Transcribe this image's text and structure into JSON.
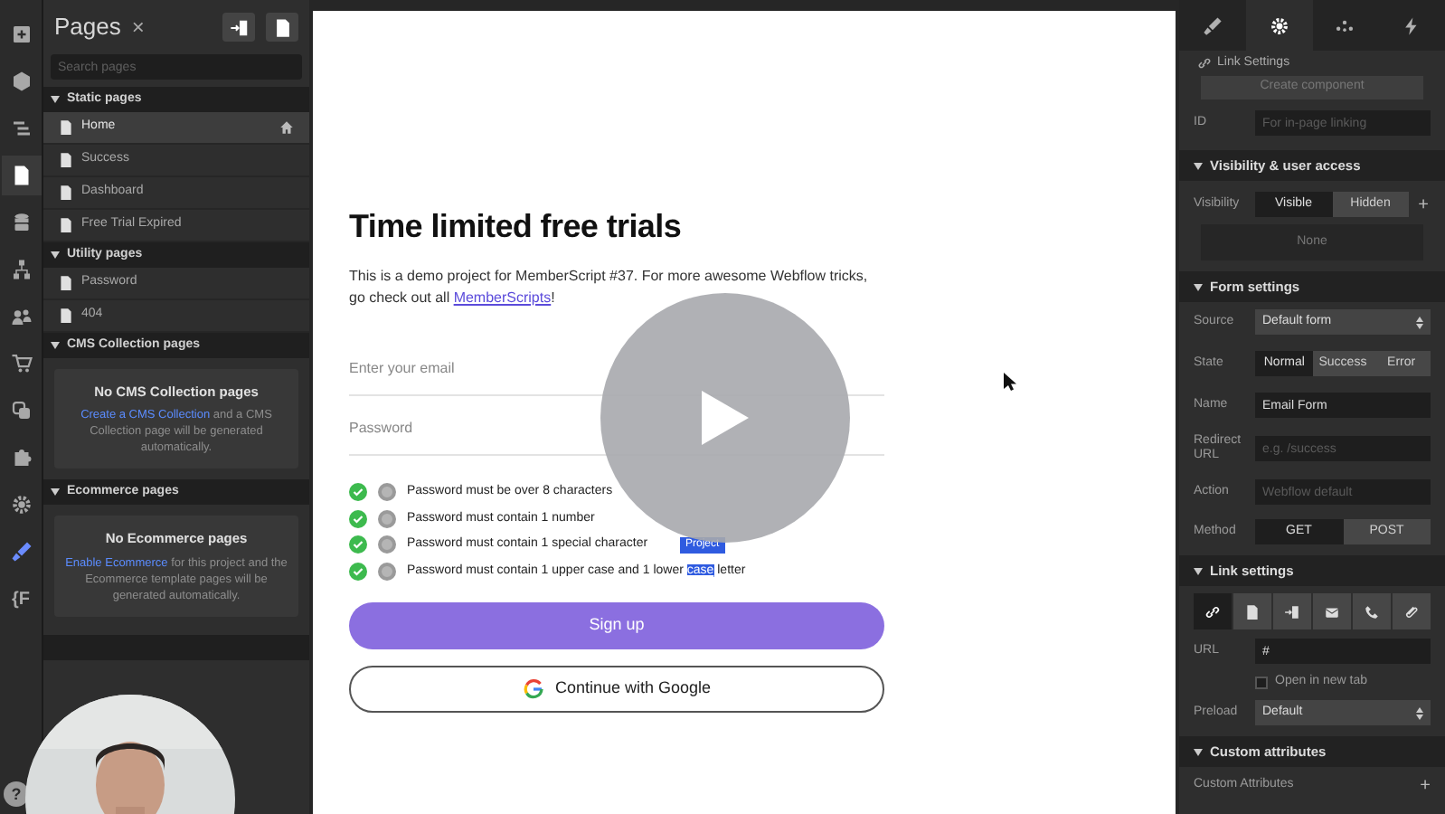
{
  "rail": [
    {
      "kind": "plus",
      "selected": false
    },
    {
      "kind": "cube",
      "selected": false
    },
    {
      "kind": "navigator",
      "selected": false
    },
    {
      "kind": "page",
      "selected": true
    },
    {
      "kind": "database",
      "selected": false
    },
    {
      "kind": "sitemap",
      "selected": false
    },
    {
      "kind": "users",
      "selected": false
    },
    {
      "kind": "cart",
      "selected": false
    },
    {
      "kind": "layers",
      "selected": false
    },
    {
      "kind": "puzzle",
      "selected": false
    },
    {
      "kind": "gear",
      "selected": false
    },
    {
      "kind": "brush",
      "selected": false
    },
    {
      "kind": "text",
      "label": "{F",
      "selected": false
    }
  ],
  "help": "?",
  "pages_panel": {
    "title": "Pages",
    "close": "×",
    "search": {
      "placeholder": "Search pages"
    },
    "sections": [
      {
        "title": "Static pages",
        "pages": [
          {
            "name": "Home",
            "selected": true,
            "home": true
          },
          {
            "name": "Success",
            "selected": false,
            "home": false
          },
          {
            "name": "Dashboard",
            "selected": false,
            "home": false
          },
          {
            "name": "Free Trial Expired",
            "selected": false,
            "home": false
          }
        ]
      },
      {
        "title": "Utility pages",
        "pages": [
          {
            "name": "Password",
            "selected": false,
            "home": false
          },
          {
            "name": "404",
            "selected": false,
            "home": false
          }
        ]
      },
      {
        "title": "CMS Collection pages",
        "empty": {
          "heading": "No CMS Collection pages",
          "link": "Create a CMS Collection",
          "text": " and a CMS Collection page will be generated automatically."
        }
      },
      {
        "title": "Ecommerce pages",
        "empty": {
          "heading": "No Ecommerce pages",
          "link": "Enable Ecommerce",
          "text": " for this project and the Ecommerce template pages will be generated automatically."
        }
      }
    ]
  },
  "canvas": {
    "heading": "Time limited free trials",
    "intro": "This is a demo project for MemberScript #37. For more awesome Webflow tricks, go check out all ",
    "intro_link": "MemberScripts",
    "intro_end": "!",
    "fields": [
      {
        "placeholder": "Enter your email"
      },
      {
        "placeholder": "Password"
      }
    ],
    "requirements": [
      {
        "text": "Password must be over 8 characters",
        "done": true
      },
      {
        "text": "Password must contain 1 number",
        "done": true
      },
      {
        "text": "Password must contain 1 special character",
        "done": true
      },
      {
        "text": "Password must contain 1 upper case and 1 lower ",
        "highlight": "case",
        "after": " letter",
        "done": true
      }
    ],
    "tag": "Project",
    "signup": "Sign up",
    "google": "Continue with Google"
  },
  "right_panel": {
    "tabs": [
      {
        "kind": "brush",
        "selected": false
      },
      {
        "kind": "gear",
        "selected": true
      },
      {
        "kind": "interactions",
        "selected": false
      },
      {
        "kind": "bolt",
        "selected": false
      }
    ],
    "link_settings_label": "Link Settings",
    "create_component": "Create component",
    "id_label": "ID",
    "id_placeholder": "For in-page linking",
    "visibility": {
      "title": "Visibility & user access",
      "label": "Visibility",
      "options": [
        {
          "label": "Visible",
          "selected": true
        },
        {
          "label": "Hidden",
          "selected": false
        }
      ],
      "add": "+",
      "none": "None"
    },
    "form": {
      "title": "Form settings",
      "source_label": "Source",
      "source": "Default form",
      "state_label": "State",
      "states": [
        {
          "label": "Normal",
          "selected": true
        },
        {
          "label": "Success",
          "selected": false
        },
        {
          "label": "Error",
          "selected": false
        }
      ],
      "name_label": "Name",
      "name": "Email Form",
      "redirect_label": "Redirect URL",
      "redirect_placeholder": "e.g. /success",
      "action_label": "Action",
      "action_placeholder": "Webflow default",
      "method_label": "Method",
      "methods": [
        {
          "label": "GET",
          "selected": true
        },
        {
          "label": "POST",
          "selected": false
        }
      ]
    },
    "link": {
      "title": "Link settings",
      "types": [
        {
          "kind": "link",
          "selected": true
        },
        {
          "kind": "page",
          "selected": false
        },
        {
          "kind": "section",
          "selected": false
        },
        {
          "kind": "email",
          "selected": false
        },
        {
          "kind": "phone",
          "selected": false
        },
        {
          "kind": "file",
          "selected": false
        }
      ],
      "url_label": "URL",
      "url": "#",
      "new_tab": {
        "label": "Open in new tab",
        "checked": false
      },
      "preload_label": "Preload",
      "preload": "Default"
    },
    "custom": {
      "title": "Custom attributes",
      "label": "Custom Attributes",
      "add": "+"
    }
  }
}
